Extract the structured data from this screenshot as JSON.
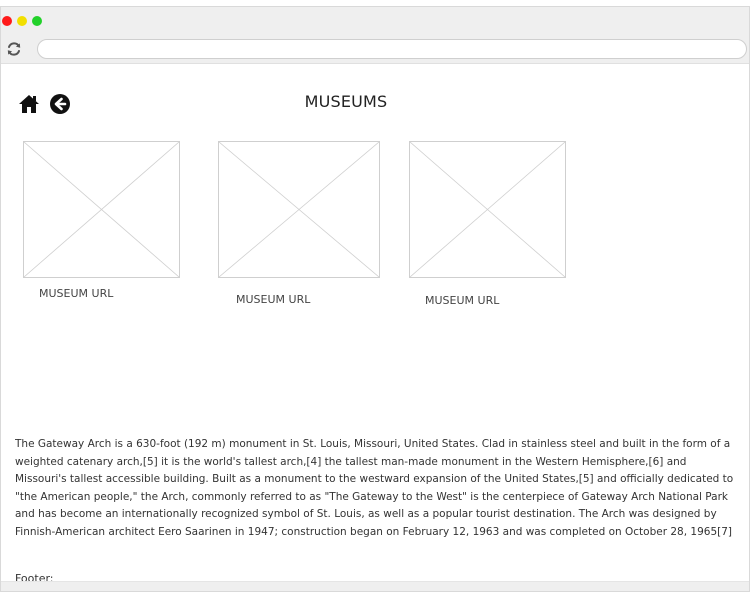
{
  "browser": {
    "window_controls": {
      "close_color": "#ff1a1a",
      "minimize_color": "#f2df00",
      "maximize_color": "#22d12a"
    },
    "reload_icon": "reload-icon",
    "address": {
      "value": "",
      "placeholder": ""
    }
  },
  "header": {
    "title": "MUSEUMS",
    "home_icon": "home-icon",
    "back_icon": "back-arrow-icon"
  },
  "museums": [
    {
      "label": "MUSEUM URL",
      "image_icon": "image-placeholder-icon"
    },
    {
      "label": "MUSEUM URL",
      "image_icon": "image-placeholder-icon"
    },
    {
      "label": "MUSEUM URL",
      "image_icon": "image-placeholder-icon"
    }
  ],
  "description": "The Gateway Arch is a 630-foot (192 m) monument in St. Louis, Missouri, United States. Clad in stainless steel and built in the form of a weighted catenary arch,[5] it is the world's tallest arch,[4] the tallest man-made monument in the Western Hemisphere,[6] and Missouri's tallest accessible building. Built as a monument to the westward expansion of the United States,[5] and officially dedicated to \"the American people,\" the Arch, commonly referred to as \"The Gateway to the West\" is the centerpiece of Gateway Arch National Park and has become an internationally recognized symbol of St. Louis, as well as a popular tourist destination. The Arch was designed by Finnish-American architect Eero Saarinen in 1947; construction began on February 12, 1963 and was completed on October 28, 1965[7]",
  "footer": {
    "label": "Footer:"
  }
}
